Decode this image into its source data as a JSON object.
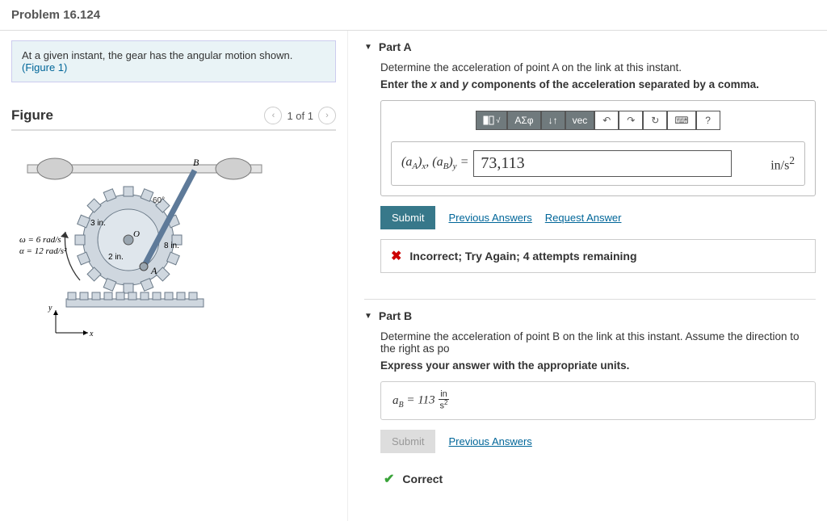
{
  "problem": {
    "title": "Problem 16.124"
  },
  "prompt": {
    "text": "At a given instant, the gear has the angular motion shown.",
    "figure_link": "(Figure 1)"
  },
  "figure": {
    "title": "Figure",
    "pager": {
      "prev": "‹",
      "label": "1 of 1",
      "next": "›"
    },
    "labels": {
      "B": "B",
      "A": "A",
      "O": "O",
      "angle": "60°",
      "r_outer": "3 in.",
      "r_inner": "2 in.",
      "len8": "8 in.",
      "omega": "ω = 6 rad/s",
      "alpha": "α = 12 rad/s²",
      "x": "x",
      "y": "y"
    }
  },
  "partA": {
    "label": "Part A",
    "instr1": "Determine the acceleration of point A on the link at this instant.",
    "instr2a": "Enter the ",
    "instr2x": "x",
    "instr2b": " and ",
    "instr2y": "y",
    "instr2c": " components of the acceleration separated by a comma.",
    "toolbar": {
      "tpl": "tpl",
      "sqrt": "√",
      "greek": "ΑΣφ",
      "frac_arrows": "↓↑",
      "vec": "vec",
      "undo": "↶",
      "redo": "↷",
      "reset": "↻",
      "keyboard": "⌨",
      "help": "?"
    },
    "lhs": "(aA)x, (aB)y = ",
    "value": "73,113",
    "units": "in/s²",
    "submit": "Submit",
    "prev_answers": "Previous Answers",
    "req_answer": "Request Answer",
    "feedback": "Incorrect; Try Again; 4 attempts remaining"
  },
  "partB": {
    "label": "Part B",
    "instr1": "Determine the acceleration of point B on the link at this instant. Assume the direction to the right as po",
    "instr2": "Express your answer with the appropriate units.",
    "lhs": "aB = ",
    "value": "113",
    "units_num": "in",
    "units_den": "s²",
    "submit": "Submit",
    "prev_answers": "Previous Answers",
    "feedback": "Correct"
  }
}
